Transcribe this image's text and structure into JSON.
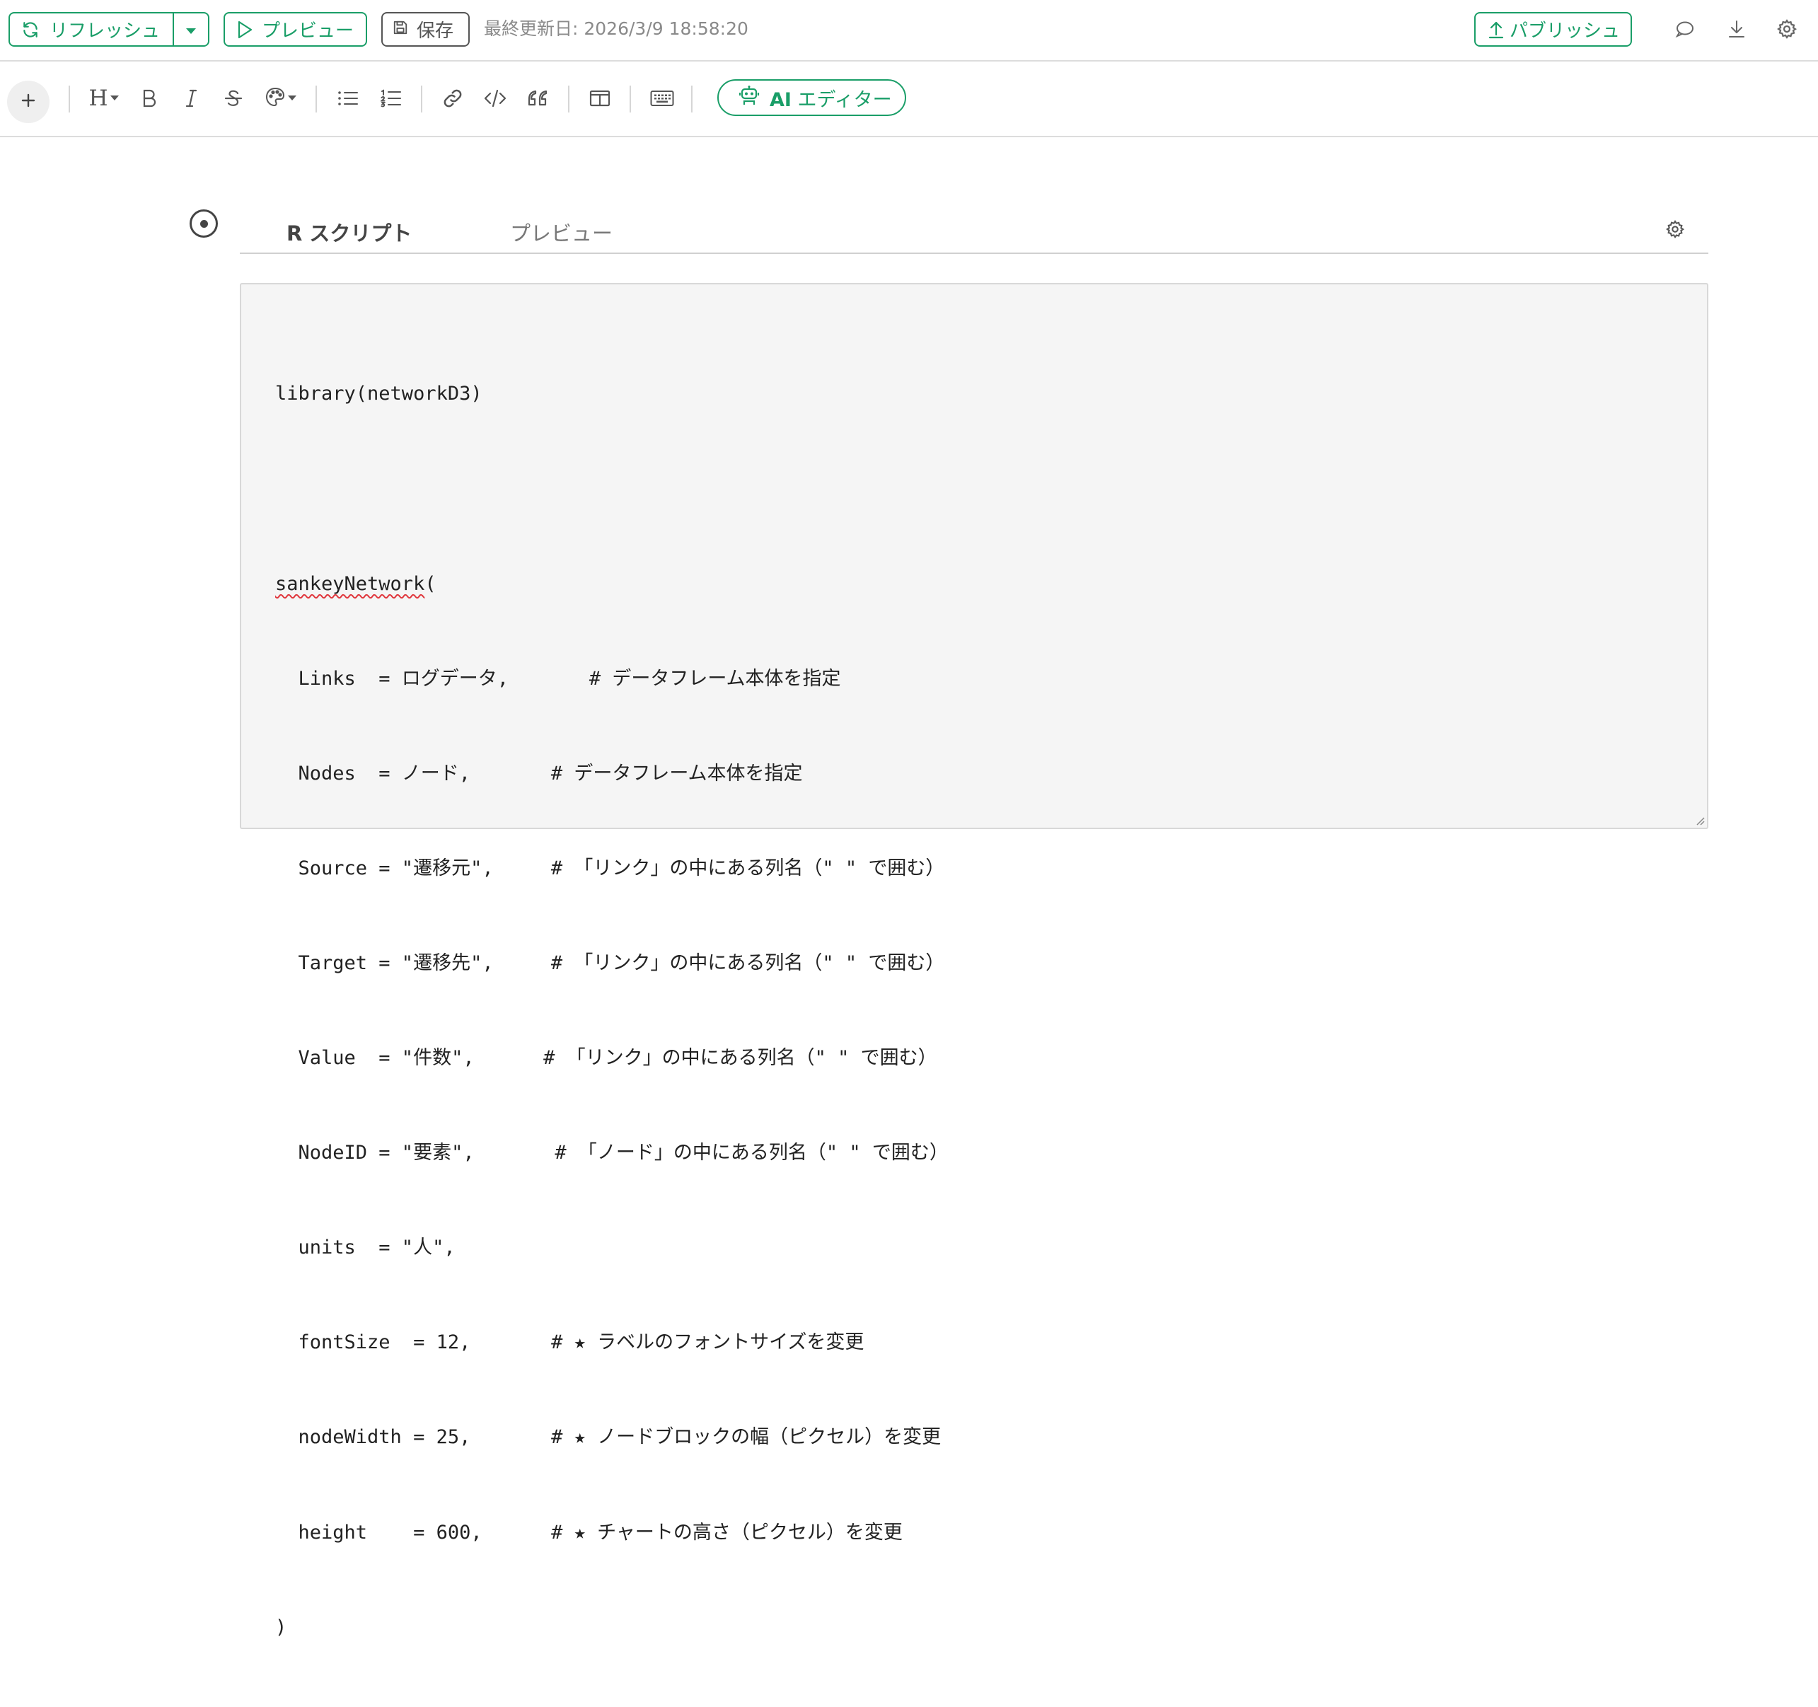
{
  "topbar": {
    "refresh_label": "リフレッシュ",
    "preview_label": "プレビュー",
    "save_label": "保存",
    "last_updated": "最終更新日: 2026/3/9 18:58:20",
    "publish_label": "パブリッシュ",
    "icons": [
      "refresh-icon",
      "caret-down-icon",
      "play-icon",
      "save-icon",
      "upload-icon",
      "comment-icon",
      "download-icon",
      "gear-icon"
    ]
  },
  "toolbar": {
    "heading_label": "H",
    "ai_editor_prefix": "AI",
    "ai_editor_label": " エディター",
    "icons": [
      "plus-icon",
      "heading-icon",
      "bold-icon",
      "italic-icon",
      "strikethrough-icon",
      "palette-icon",
      "bullet-list-icon",
      "numbered-list-icon",
      "link-icon",
      "code-icon",
      "quote-icon",
      "columns-icon",
      "keyboard-icon",
      "robot-icon"
    ]
  },
  "chunk": {
    "tab_script": "R スクリプト",
    "tab_preview": "プレビュー",
    "code_lines": [
      "library(networkD3)",
      "",
      "sankeyNetwork(",
      "  Links  = ログデータ,       # データフレーム本体を指定",
      "  Nodes  = ノード,       # データフレーム本体を指定",
      "  Source = \"遷移元\",     # 「リンク」の中にある列名（\" \" で囲む）",
      "  Target = \"遷移先\",     # 「リンク」の中にある列名（\" \" で囲む）",
      "  Value  = \"件数\",      # 「リンク」の中にある列名（\" \" で囲む）",
      "  NodeID = \"要素\",       # 「ノード」の中にある列名（\" \" で囲む）",
      "  units  = \"人\",",
      "  fontSize  = 12,       # ★ ラベルのフォントサイズを変更",
      "  nodeWidth = 25,       # ★ ノードブロックの幅（ピクセル）を変更",
      "  height    = 600,      # ★ チャートの高さ（ピクセル）を変更",
      ")"
    ]
  },
  "colors": {
    "accent": "#1a9e68",
    "editor_bg": "#f5f5f5",
    "muted_text": "#8a8a8a"
  }
}
